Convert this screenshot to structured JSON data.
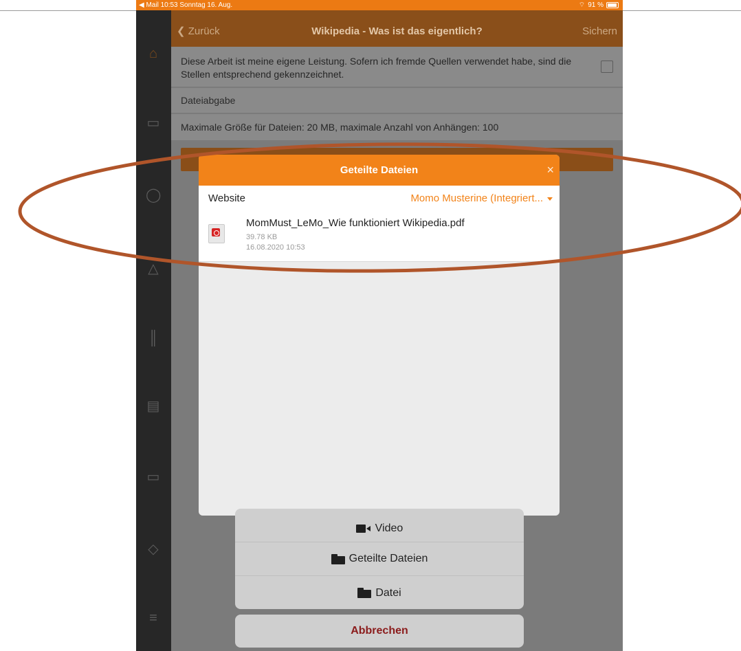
{
  "status_bar": {
    "left": "◀ Mail  10:53  Sonntag 16. Aug.",
    "battery": "91 %"
  },
  "nav": {
    "back": "Zurück",
    "title": "Wikipedia - Was ist das eigentlich?",
    "save": "Sichern"
  },
  "content": {
    "declaration": "Diese Arbeit ist meine eigene Leistung. Sofern ich fremde Quellen verwendet habe, sind die Stellen entsprechend gekennzeichnet.",
    "section": "Dateiabgabe",
    "limits": "Maximale Größe für Dateien: 20 MB, maximale Anzahl von Anhängen: 100"
  },
  "modal": {
    "title": "Geteilte Dateien",
    "close": "×",
    "filter_label": "Website",
    "filter_value": "Momo Musterine (Integriert...",
    "file": {
      "name": "MomMust_LeMo_Wie funktioniert Wikipedia.pdf",
      "size": "39.78 KB",
      "date": "16.08.2020 10:53"
    }
  },
  "sheet": {
    "video": "Video",
    "shared": "Geteilte Dateien",
    "file": "Datei",
    "cancel": "Abbrechen"
  },
  "icons": {
    "sidebar": [
      "home-icon",
      "calendar-icon",
      "chat-icon",
      "bell-icon",
      "chart-icon",
      "news-icon",
      "folder-icon",
      "tag-icon",
      "menu-icon"
    ]
  },
  "colors": {
    "accent": "#f28319",
    "annotation": "#b0552a"
  }
}
